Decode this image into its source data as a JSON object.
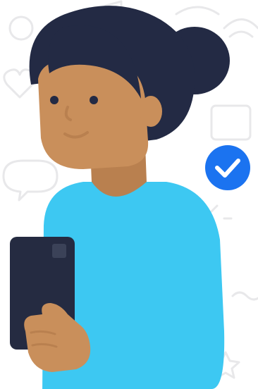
{
  "illustration": {
    "subject": "person-holding-phone",
    "badge_icon": "check-icon"
  },
  "colors": {
    "background": "#ffffff",
    "doodle_outline": "#e8e8ea",
    "hair": "#232a44",
    "skin": "#c98f5b",
    "skin_shadow": "#b9804f",
    "shirt": "#3dc8f2",
    "phone": "#252b41",
    "phone_camera": "#3b4258",
    "badge": "#1b73f0",
    "badge_check": "#ffffff",
    "face_features": "#232a44"
  }
}
